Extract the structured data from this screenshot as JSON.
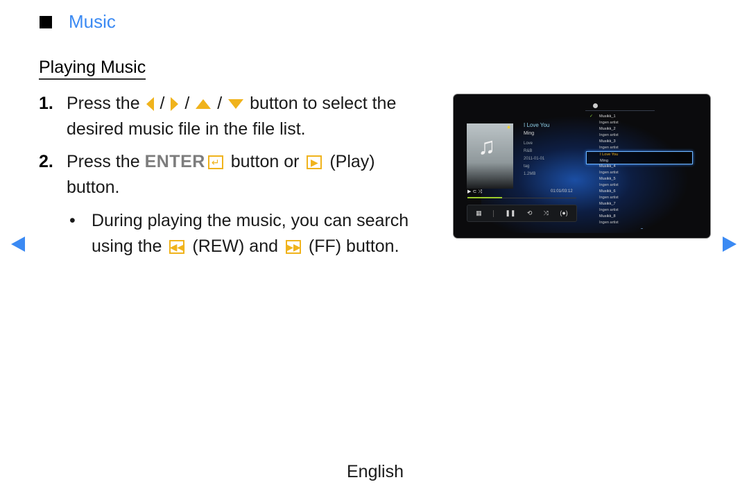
{
  "section": {
    "title": "Music",
    "bullet_icon": "black-square-icon"
  },
  "subheading": "Playing Music",
  "steps": [
    {
      "number": "1.",
      "text_before": "Press the",
      "separators": [
        "/",
        "/",
        "/"
      ],
      "icons": [
        "left-arrow-key-icon",
        "right-arrow-key-icon",
        "up-arrow-key-icon",
        "down-arrow-key-icon"
      ],
      "text_after": "button to select the",
      "line2": "desired music file in the file list."
    },
    {
      "number": "2.",
      "text_before": "Press the",
      "enter_label": "ENTER",
      "enter_icon": "enter-key-icon",
      "text_mid": "button or",
      "play_icon": "play-key-icon",
      "play_label": "(Play)",
      "line2": "button."
    }
  ],
  "note": {
    "bullet": "•",
    "line1": "During playing the music, you can search",
    "line2_before": "using the",
    "rew_icon": "rewind-key-icon",
    "rew_label": "(REW) and",
    "ff_icon": "fast-forward-key-icon",
    "ff_label": "(FF) button."
  },
  "navigation": {
    "prev": "previous-page-arrow",
    "next": "next-page-arrow",
    "color": "#3b8af3"
  },
  "footer": {
    "language": "English"
  },
  "tv_screen": {
    "now_playing": {
      "title": "I Love You",
      "artist": "Ming",
      "album": "Love",
      "genre": "R&B",
      "date": "2011-01-01",
      "tag": "tag",
      "size": "1.2MB",
      "elapsed_total": "01:01/03:12",
      "progress_percent": 32,
      "favorite": true
    },
    "status_icons": [
      "play-icon",
      "repeat-icon",
      "shuffle-icon"
    ],
    "controls": [
      {
        "name": "playlist-grid-button",
        "glyph": "▦"
      },
      {
        "name": "pause-button",
        "glyph": "❚❚"
      },
      {
        "name": "repeat-button",
        "glyph": "⟲"
      },
      {
        "name": "shuffle-button",
        "glyph": "⤨"
      },
      {
        "name": "sound-mode-button",
        "glyph": "(●)"
      }
    ],
    "playlist": [
      {
        "title": "Musikk_1",
        "artist": "Ingen artist",
        "checked": true,
        "selected": false
      },
      {
        "title": "Musikk_2",
        "artist": "Ingen artist",
        "checked": false,
        "selected": false
      },
      {
        "title": "Musikk_3",
        "artist": "Ingen artist",
        "checked": false,
        "selected": false
      },
      {
        "title": "I Love You",
        "artist": "Ming",
        "checked": false,
        "selected": true
      },
      {
        "title": "Musikk_4",
        "artist": "Ingen artist",
        "checked": false,
        "selected": false
      },
      {
        "title": "Musikk_5",
        "artist": "Ingen artist",
        "checked": false,
        "selected": false
      },
      {
        "title": "Musikk_6",
        "artist": "Ingen artist",
        "checked": false,
        "selected": false
      },
      {
        "title": "Musikk_7",
        "artist": "Ingen artist",
        "checked": false,
        "selected": false
      },
      {
        "title": "Musikk_8",
        "artist": "Ingen artist",
        "checked": false,
        "selected": false
      }
    ],
    "colors": {
      "accent_key": "#f0b31c",
      "selection": "#6fb6ff",
      "progress": "#9ccc2c"
    }
  }
}
